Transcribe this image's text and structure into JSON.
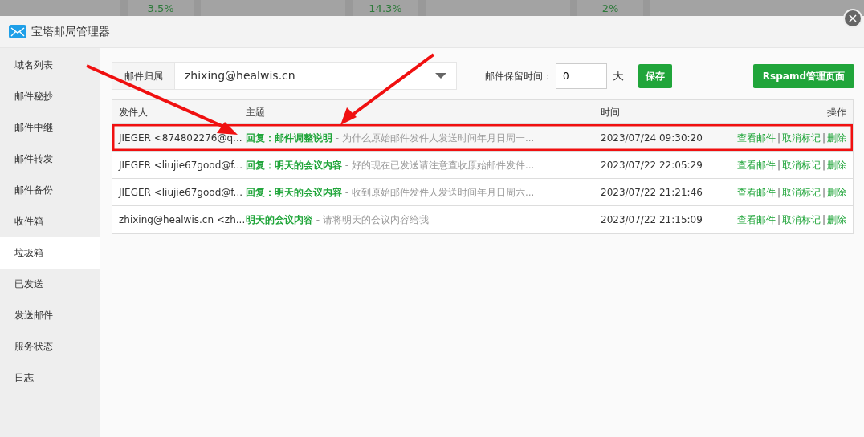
{
  "backdrop": {
    "gauges": [
      "3.5%",
      "14.3%",
      "2%"
    ]
  },
  "window": {
    "title": "宝塔邮局管理器",
    "close": "×"
  },
  "sidebar": {
    "items": [
      {
        "label": "域名列表",
        "selected": false
      },
      {
        "label": "邮件秘抄",
        "selected": false
      },
      {
        "label": "邮件中继",
        "selected": false
      },
      {
        "label": "邮件转发",
        "selected": false
      },
      {
        "label": "邮件备份",
        "selected": false
      },
      {
        "label": "收件箱",
        "selected": false
      },
      {
        "label": "垃圾箱",
        "selected": true
      },
      {
        "label": "已发送",
        "selected": false
      },
      {
        "label": "发送邮件",
        "selected": false
      },
      {
        "label": "服务状态",
        "selected": false
      },
      {
        "label": "日志",
        "selected": false
      }
    ]
  },
  "toolbar": {
    "owner_label": "邮件归属",
    "owner_value": "zhixing@healwis.cn",
    "retention_label": "邮件保留时间：",
    "retention_value": "0",
    "retention_unit": "天",
    "save_button": "保存",
    "rspamd_button": "Rspamd管理页面"
  },
  "table": {
    "columns": [
      "发件人",
      "主题",
      "时间",
      "操作"
    ],
    "rows": [
      {
        "sender": "JIEGER <874802276@q...",
        "subject": "回复：邮件调整说明",
        "preview": " - 为什么原始邮件发件人发送时间年月日周一...",
        "time": "2023/07/24 09:30:20",
        "actions": [
          {
            "kind": "link",
            "text": "查看邮件"
          },
          {
            "kind": "separator",
            "text": "|"
          },
          {
            "kind": "link",
            "text": "取消标记"
          },
          {
            "kind": "separator",
            "text": "|"
          },
          {
            "kind": "link",
            "text": "删除"
          }
        ],
        "highlighted": true
      },
      {
        "sender": "JIEGER <liujie67good@f...",
        "subject": "回复：明天的会议内容",
        "preview": " - 好的现在已发送请注意查收原始邮件发件...",
        "time": "2023/07/22 22:05:29",
        "actions": [
          {
            "kind": "link",
            "text": "查看邮件"
          },
          {
            "kind": "separator",
            "text": "|"
          },
          {
            "kind": "link",
            "text": "取消标记"
          },
          {
            "kind": "separator",
            "text": "|"
          },
          {
            "kind": "link",
            "text": "删除"
          }
        ],
        "highlighted": false
      },
      {
        "sender": "JIEGER <liujie67good@f...",
        "subject": "回复：明天的会议内容",
        "preview": " - 收到原始邮件发件人发送时间年月日周六...",
        "time": "2023/07/22 21:21:46",
        "actions": [
          {
            "kind": "link",
            "text": "查看邮件"
          },
          {
            "kind": "separator",
            "text": "|"
          },
          {
            "kind": "link",
            "text": "取消标记"
          },
          {
            "kind": "separator",
            "text": "|"
          },
          {
            "kind": "link",
            "text": "删除"
          }
        ],
        "highlighted": false
      },
      {
        "sender": "zhixing@healwis.cn <zh...",
        "subject": "明天的会议内容",
        "preview": " - 请将明天的会议内容给我",
        "time": "2023/07/22 21:15:09",
        "actions": [
          {
            "kind": "link",
            "text": "查看邮件"
          },
          {
            "kind": "separator",
            "text": "|"
          },
          {
            "kind": "link",
            "text": "取消标记"
          },
          {
            "kind": "separator",
            "text": "|"
          },
          {
            "kind": "link",
            "text": "删除"
          }
        ],
        "highlighted": false
      }
    ]
  }
}
